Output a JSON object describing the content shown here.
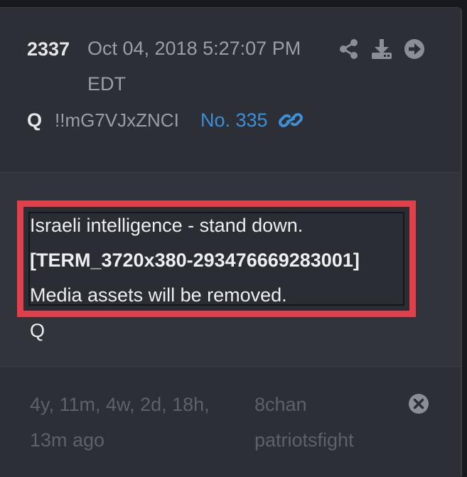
{
  "post": {
    "number": "2337",
    "date": "Oct 04, 2018 5:27:07 PM EDT",
    "author": "Q",
    "tripcode": "!!mG7VJxZNCI",
    "post_link": "No. 335"
  },
  "icons": {
    "share": "share-icon",
    "download": "download-icon",
    "forward": "arrow-right-circle-icon",
    "link": "link-icon",
    "close": "close-circle-icon"
  },
  "message": {
    "lines": [
      "Israeli intelligence - stand down.",
      "[TERM_3720x380-293476669283001]",
      "Media assets will be removed.",
      "Q"
    ]
  },
  "footer": {
    "age": "4y, 11m, 4w, 2d, 18h, 13m ago",
    "board_line1": "8chan",
    "board_line2": "patriotsfight"
  },
  "colors": {
    "background": "#2c2f36",
    "highlight_border": "#e0404a",
    "link": "#3d8fd6"
  }
}
